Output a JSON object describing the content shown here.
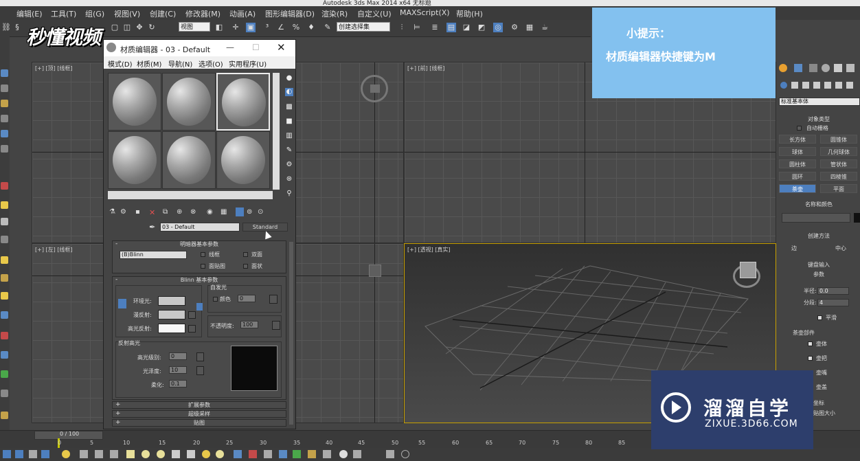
{
  "window": {
    "title": "Autodesk 3ds Max 2014 x64 无标题"
  },
  "menubar": [
    "编辑(E)",
    "工具(T)",
    "组(G)",
    "视图(V)",
    "创建(C)",
    "修改器(M)",
    "动画(A)",
    "图形编辑器(D)",
    "渲染(R)",
    "自定义(U)",
    "MAXScript(X)",
    "帮助(H)"
  ],
  "toolbar": {
    "view_select": "视图",
    "named_selection": "创建选择集"
  },
  "watermark_logo": "秒懂视频",
  "tip": {
    "title": "小提示：",
    "text": "材质编辑器快捷键为M"
  },
  "viewports": {
    "top_left": "[+] [顶] [线框]",
    "top_right": "[+] [前] [线框]",
    "bottom_left": "[+] [左] [线框]",
    "bottom_right": "[+] [透视] [真实]"
  },
  "material_editor": {
    "title": "材质编辑器 - 03 - Default",
    "menu": [
      "模式(D)",
      "材质(M)",
      "导航(N)",
      "选项(O)",
      "实用程序(U)"
    ],
    "material_name": "03 - Default",
    "material_type": "Standard",
    "shader_rollout": {
      "title": "明暗器基本参数",
      "shader": "(B)Blinn",
      "wire": "线框",
      "two_sided": "双面",
      "face_map": "面贴图",
      "faceted": "面状"
    },
    "blinn_rollout": {
      "title": "Blinn 基本参数",
      "self_illum_title": "自发光",
      "ambient": "环境光:",
      "diffuse": "漫反射:",
      "specular": "高光反射:",
      "color_label": "颜色",
      "self_illum_value": "0",
      "opacity_label": "不透明度:",
      "opacity_value": "100",
      "spec_highlights": "反射高光",
      "spec_level_label": "高光级别:",
      "spec_level": "0",
      "glossiness_label": "光泽度:",
      "glossiness": "10",
      "soften_label": "柔化:",
      "soften": "0.1"
    },
    "collapsed_rollouts": [
      "扩展参数",
      "超级采样",
      "贴图"
    ]
  },
  "command_panel": {
    "dropdown": "标准基本体",
    "object_type": "对象类型",
    "autogrid": "自动栅格",
    "buttons": [
      "长方体",
      "圆锥体",
      "球体",
      "几何球体",
      "圆柱体",
      "管状体",
      "圆环",
      "四棱锥",
      "茶壶",
      "平面"
    ],
    "active_button": "茶壶",
    "name_color": "名称和颜色",
    "creation_method": "创建方法",
    "edge": "边",
    "center": "中心",
    "keyboard_entry": "键盘输入",
    "parameters": "参数",
    "radius_label": "半径:",
    "radius": "0.0",
    "segments_label": "分段:",
    "segments": "4",
    "smooth": "平滑",
    "teapot_parts": "茶壶部件",
    "body": "壶体",
    "handle": "壶把",
    "spout": "壶嘴",
    "lid": "壶盖",
    "gen_coords": "坐标",
    "real_world": "贴图大小"
  },
  "timeline": {
    "frame": "0 / 100",
    "ticks": [
      "0",
      "5",
      "10",
      "15",
      "20",
      "25",
      "30",
      "35",
      "40",
      "45",
      "50",
      "55",
      "60",
      "65",
      "70",
      "75",
      "80",
      "85"
    ]
  },
  "watermark_site": {
    "name": "溜溜自学",
    "url": "ZIXUE.3D66.COM"
  }
}
